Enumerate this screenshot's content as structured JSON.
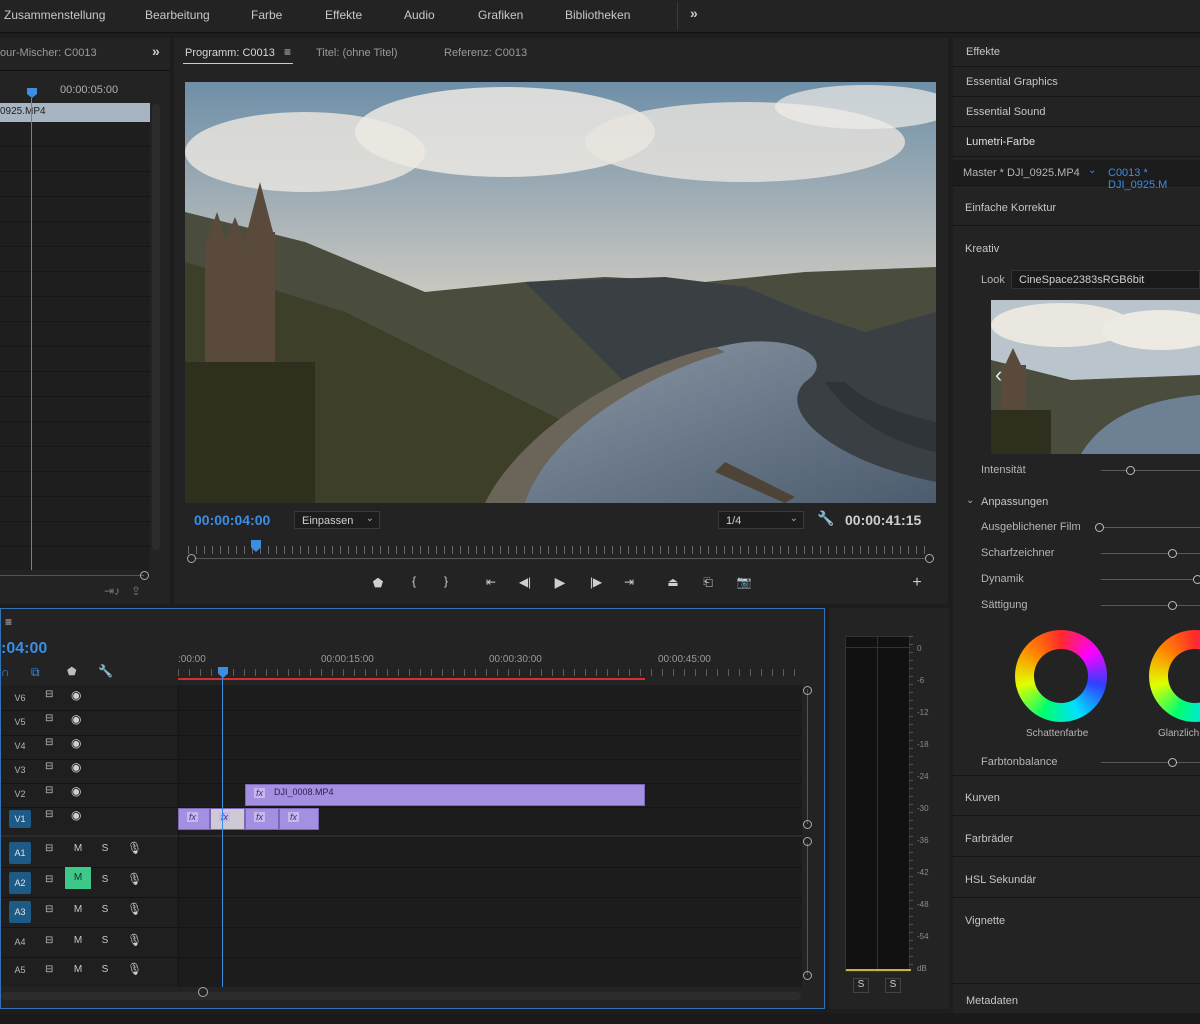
{
  "menubar": {
    "items": [
      "Zusammenstellung",
      "Bearbeitung",
      "Farbe",
      "Effekte",
      "Audio",
      "Grafiken",
      "Bibliotheken"
    ],
    "overflow_icon": "double-chevron-right-icon"
  },
  "source_panel": {
    "tab_label": "our-Mischer: C0013",
    "ruler_time": "00:00:05:00",
    "clip_name": "0925.MP4"
  },
  "program_panel": {
    "tabs": [
      "Programm: C0013",
      "Titel: (ohne Titel)",
      "Referenz: C0013"
    ],
    "current_time": "00:00:04:00",
    "fit_select": "Einpassen",
    "resolution_select": "1/4",
    "duration": "00:00:41:15"
  },
  "timeline": {
    "current_time": ":04:00",
    "ruler_labels": [
      ":00:00",
      "00:00:15:00",
      "00:00:30:00",
      "00:00:45:00"
    ],
    "video_tracks": [
      "V6",
      "V5",
      "V4",
      "V3",
      "V2",
      "V1"
    ],
    "audio_tracks": [
      "A1",
      "A2",
      "A3",
      "A4",
      "A5"
    ],
    "mute_label": "M",
    "solo_label": "S",
    "clip_v2": "DJI_0008.MP4",
    "fx_label": "fx"
  },
  "meter": {
    "db_labels": [
      "0",
      "-6",
      "-12",
      "-18",
      "-24",
      "-30",
      "-36",
      "-42",
      "-48",
      "-54",
      "dB"
    ],
    "solo_buttons": [
      "S",
      "S"
    ]
  },
  "right_panel": {
    "sections": [
      "Effekte",
      "Essential Graphics",
      "Essential Sound",
      "Lumetri-Farbe"
    ],
    "master_tab": "Master * DJI_0925.MP4",
    "clip_tab": "C0013 * DJI_0925.M",
    "basic_correction": "Einfache Korrektur",
    "creative": "Kreativ",
    "look_label": "Look",
    "look_value": "CineSpace2383sRGB6bit",
    "intensity": "Intensität",
    "adjustments": "Anpassungen",
    "adjust_items": [
      "Ausgeblichener Film",
      "Scharfzeichner",
      "Dynamik",
      "Sättigung"
    ],
    "wheel_labels": [
      "Schattenfarbe",
      "Glanzlich"
    ],
    "tint_balance": "Farbtonbalance",
    "bottom_sections": [
      "Kurven",
      "Farbräder",
      "HSL Sekundär",
      "Vignette"
    ],
    "metadata": "Metadaten"
  }
}
